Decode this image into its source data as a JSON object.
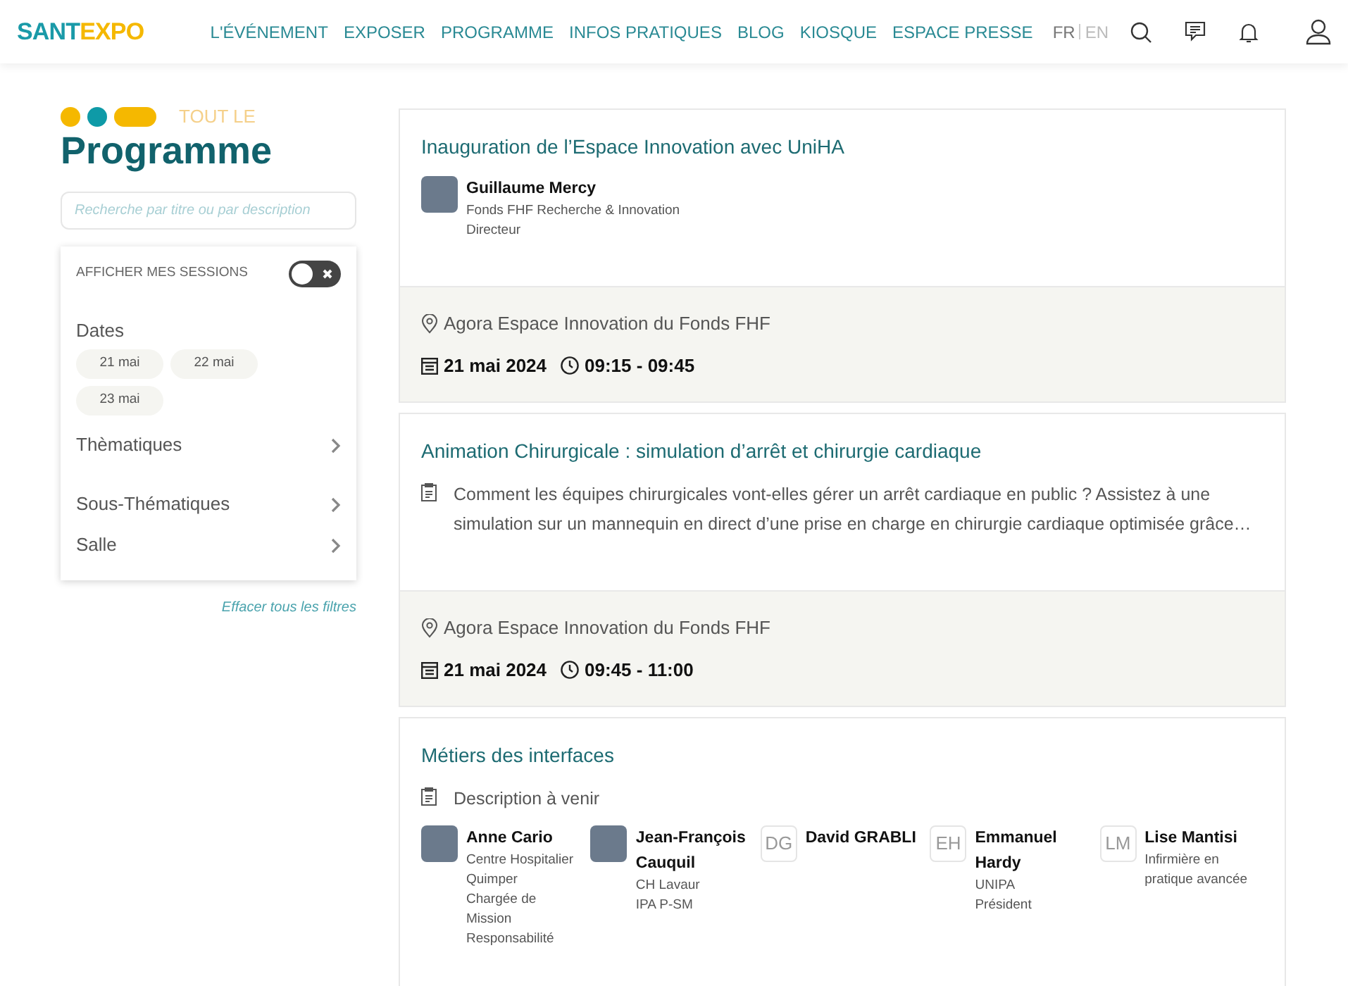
{
  "header": {
    "logo": {
      "part_1": "SANT",
      "part_2": "E",
      "part_3": "XPO"
    },
    "nav": [
      {
        "label": "L'ÉVÉNEMENT"
      },
      {
        "label": "EXPOSER"
      },
      {
        "label": "PROGRAMME"
      },
      {
        "label": "INFOS PRATIQUES"
      },
      {
        "label": "BLOG"
      },
      {
        "label": "KIOSQUE"
      },
      {
        "label": "ESPACE PRESSE"
      }
    ],
    "languages": [
      {
        "label": "FR",
        "selected": true
      },
      {
        "label": "EN",
        "selected": false
      }
    ]
  },
  "sidebar": {
    "kicker": "TOUT LE",
    "title": "Programme",
    "search": {
      "placeholder": "Recherche par titre ou par description"
    },
    "my_sessions": {
      "label": "AFFICHER MES SESSIONS",
      "on": false
    },
    "dates": {
      "label": "Dates",
      "chips": [
        {
          "label": "21 mai",
          "selected": false
        },
        {
          "label": "22 mai",
          "selected": false
        },
        {
          "label": "23 mai",
          "selected": false
        }
      ]
    },
    "filters": [
      {
        "label": "Thèmatiques"
      },
      {
        "label": "Sous-Thématiques"
      },
      {
        "label": "Salle"
      }
    ],
    "clear": "Effacer tous les filtres"
  },
  "sessions": [
    {
      "title": "Inauguration de l’Espace Innovation avec UniHA",
      "speakers": [
        {
          "kind": "photo",
          "name": "Guillaume Mercy",
          "lines": [
            "Fonds FHF Recherche & Innovation",
            "Directeur"
          ]
        }
      ],
      "location": "Agora Espace Innovation du Fonds FHF",
      "date": "21 mai 2024",
      "time": "09:15 - 09:45"
    },
    {
      "title": "Animation Chirurgicale : simulation d’arrêt et chirurgie cardiaque",
      "description": "Comment les équipes chirurgicales vont-elles gérer un arrêt cardiaque en public ? Assistez à une simulation sur un mannequin en direct d’une prise en charge en chirurgie cardiaque optimisée grâce…",
      "location": "Agora Espace Innovation du Fonds FHF",
      "date": "21 mai 2024",
      "time": "09:45 - 11:00"
    },
    {
      "title": "Métiers des interfaces",
      "description": "Description à venir",
      "speakers": [
        {
          "kind": "photo",
          "name": "Anne Cario",
          "lines": [
            "Centre Hospitalier Quimper",
            "Chargée de Mission",
            "Responsabilité"
          ]
        },
        {
          "kind": "photo",
          "name": "Jean-François Cauquil",
          "lines": [
            "CH Lavaur",
            "IPA P-SM"
          ]
        },
        {
          "kind": "initials",
          "initials": "DG",
          "name": "David GRABLI"
        },
        {
          "kind": "initials",
          "initials": "EH",
          "name": "Emmanuel Hardy",
          "lines": [
            "UNIPA",
            "Président"
          ]
        },
        {
          "kind": "initials",
          "initials": "LM",
          "name": "Lise Mantisi",
          "lines": [
            "Infirmière en pratique avancée"
          ]
        }
      ]
    }
  ]
}
